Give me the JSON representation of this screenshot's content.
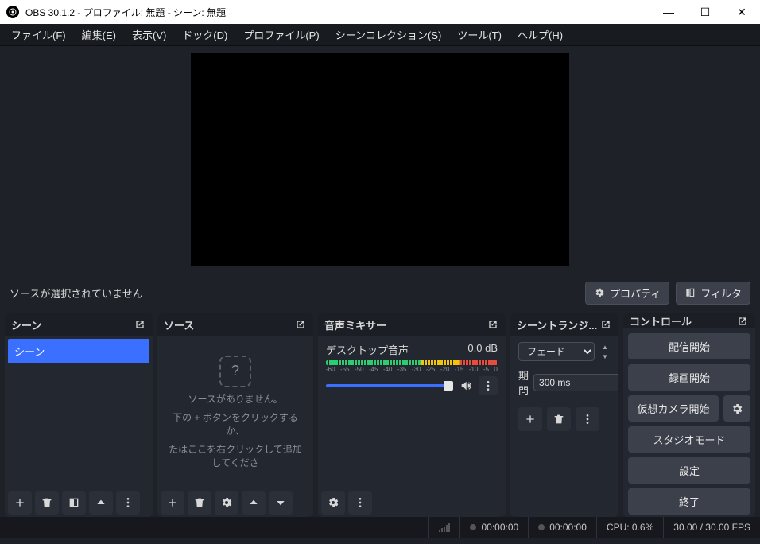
{
  "window": {
    "title": "OBS 30.1.2 - プロファイル: 無題 - シーン: 無題"
  },
  "menu": {
    "file": "ファイル(F)",
    "edit": "編集(E)",
    "view": "表示(V)",
    "dock": "ドック(D)",
    "profile": "プロファイル(P)",
    "sceneCollection": "シーンコレクション(S)",
    "tools": "ツール(T)",
    "help": "ヘルプ(H)"
  },
  "midbar": {
    "noSource": "ソースが選択されていません",
    "properties": "プロパティ",
    "filters": "フィルタ"
  },
  "docks": {
    "scenes": {
      "title": "シーン",
      "items": [
        "シーン"
      ]
    },
    "sources": {
      "title": "ソース",
      "empty1": "ソースがありません。",
      "empty2": "下の + ボタンをクリックするか、",
      "empty3": "たはここを右クリックして追加してくださ"
    },
    "mixer": {
      "title": "音声ミキサー",
      "trackName": "デスクトップ音声",
      "trackDb": "0.0 dB",
      "ticks": [
        "-60",
        "-55",
        "-50",
        "-45",
        "-40",
        "-35",
        "-30",
        "-25",
        "-20",
        "-15",
        "-10",
        "-5",
        "0"
      ]
    },
    "transitions": {
      "title": "シーントランジ...",
      "selected": "フェード",
      "durationLabel": "期間",
      "durationValue": "300 ms"
    },
    "controls": {
      "title": "コントロール",
      "startStream": "配信開始",
      "startRecord": "録画開始",
      "startVirtualCam": "仮想カメラ開始",
      "studioMode": "スタジオモード",
      "settings": "設定",
      "exit": "終了"
    }
  },
  "status": {
    "recTime": "00:00:00",
    "liveTime": "00:00:00",
    "cpu": "CPU: 0.6%",
    "fps": "30.00 / 30.00 FPS"
  }
}
